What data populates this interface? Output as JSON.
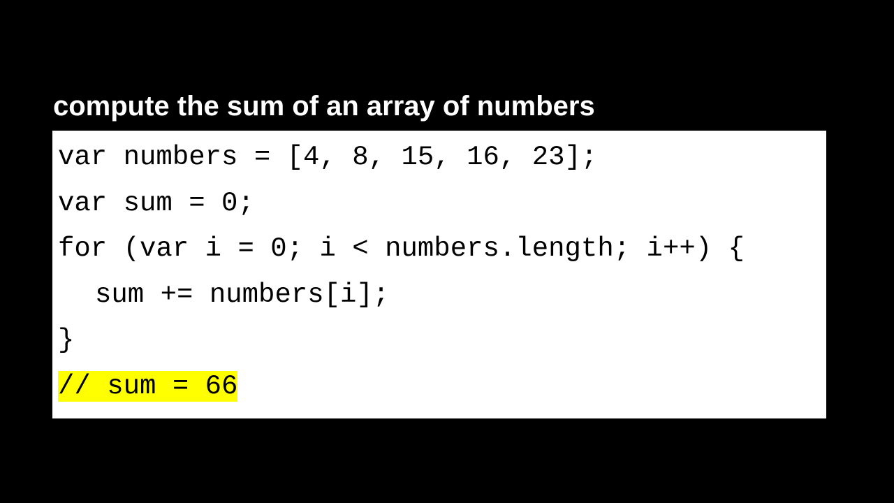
{
  "title": "compute the sum of an array of numbers",
  "code": {
    "lines": [
      "var numbers = [4, 8, 15, 16, 23];",
      "var sum = 0;",
      "for (var i = 0; i < numbers.length; i++) {",
      "sum += numbers[i];",
      "}",
      "// sum = 66"
    ],
    "highlight_color": "#ffff00"
  },
  "colors": {
    "background": "#000000",
    "code_background": "#ffffff",
    "text": "#ffffff",
    "code_text": "#000000"
  }
}
